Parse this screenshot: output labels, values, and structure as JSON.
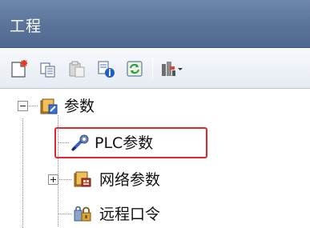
{
  "panel": {
    "title": "工程"
  },
  "toolbar": {
    "buttons": [
      {
        "icon": "new-project-icon"
      },
      {
        "icon": "copy-icon"
      },
      {
        "icon": "paste-icon"
      },
      {
        "icon": "properties-icon"
      },
      {
        "icon": "refresh-icon"
      },
      {
        "icon": "tool-settings-icon"
      }
    ]
  },
  "tree": {
    "root": {
      "label": "参数",
      "expanded": true
    },
    "plc_param": {
      "label": "PLC参数",
      "selected": true
    },
    "network_param": {
      "label": "网络参数",
      "expanded": false
    },
    "remote_password": {
      "label": "远程口令"
    }
  },
  "colors": {
    "title_bar": "#5a7399",
    "selection_outline": "#e3262f"
  }
}
